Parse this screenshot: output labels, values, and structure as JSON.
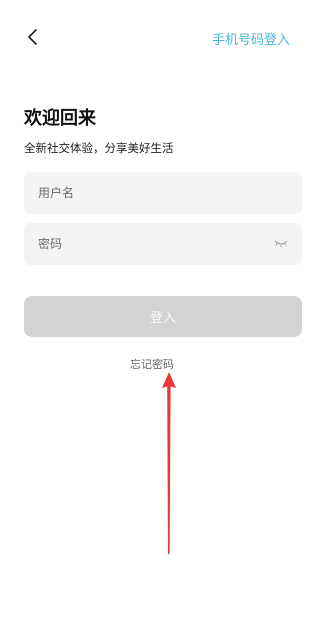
{
  "header": {
    "back_icon": "chevron-left-icon",
    "phone_login_label": "手机号码登入"
  },
  "welcome": {
    "title": "欢迎回来",
    "subtitle": "全新社交体验，分享美好生活"
  },
  "form": {
    "username_placeholder": "用户名",
    "username_value": "",
    "password_placeholder": "密码",
    "password_value": "",
    "eye_icon": "eye-closed-icon"
  },
  "actions": {
    "login_label": "登入",
    "forgot_label": "忘记密码"
  },
  "annotation": {
    "arrow_color": "#e53935"
  },
  "colors": {
    "accent": "#4db6d6",
    "button_disabled": "#d3d3d3",
    "field_bg": "#f4f4f4"
  }
}
